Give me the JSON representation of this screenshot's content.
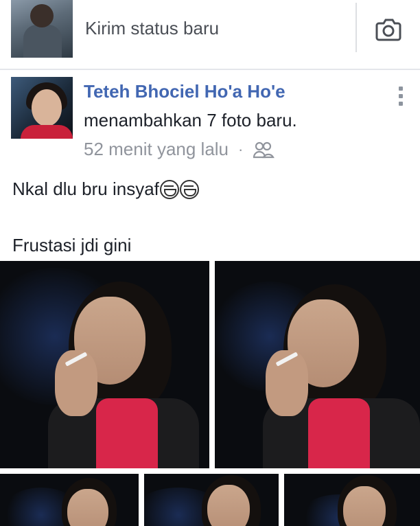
{
  "composer": {
    "prompt": "Kirim status baru",
    "camera_icon": "camera-icon"
  },
  "post": {
    "author": "Teteh Bhociel Ho'a Ho'e",
    "action": "menambahkan 7 foto baru.",
    "time": "52 menit yang lalu",
    "separator": "·",
    "audience_icon": "friends-icon",
    "more_icon": "more-vertical-icon",
    "caption_line1": "Nkal dlu bru insyaf",
    "caption_emoji": "grinning-face-emoji",
    "caption_line2": "Frustasi jdi gini",
    "photos_count": 7
  },
  "colors": {
    "author_blue": "#4267b2",
    "meta_gray": "#90949c",
    "divider": "#dddfe2"
  }
}
